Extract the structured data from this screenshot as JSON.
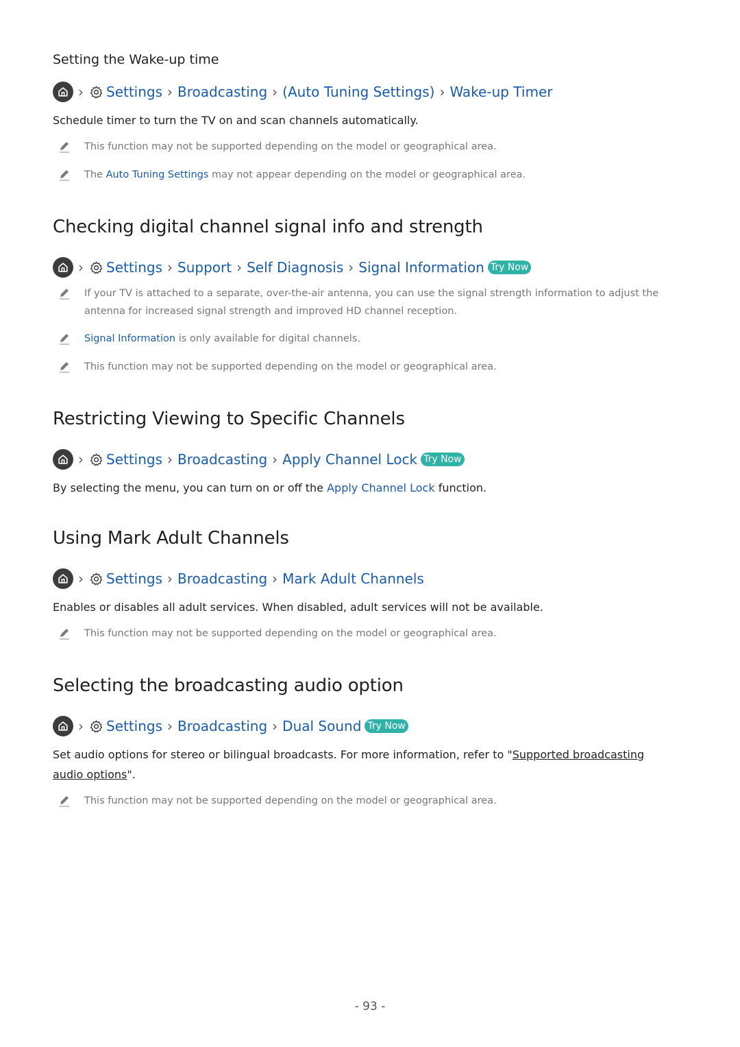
{
  "sections": {
    "wakeup": {
      "subheading": "Setting the Wake-up time",
      "breadcrumb": [
        "Settings",
        "Broadcasting",
        "Auto Tuning Settings",
        "Wake-up Timer"
      ],
      "paren_open": "(",
      "paren_close": ")",
      "body": "Schedule timer to turn the TV on and scan channels automatically.",
      "notes": [
        {
          "text": "This function may not be supported depending on the model or geographical area."
        },
        {
          "pre": "The ",
          "link": "Auto Tuning Settings",
          "post": " may not appear depending on the model or geographical area."
        }
      ]
    },
    "signal": {
      "heading": "Checking digital channel signal info and strength",
      "breadcrumb": [
        "Settings",
        "Support",
        "Self Diagnosis",
        "Signal Information"
      ],
      "try_now": "Try Now",
      "notes": [
        {
          "text": "If your TV is attached to a separate, over-the-air antenna, you can use the signal strength information to adjust the antenna for increased signal strength and improved HD channel reception."
        },
        {
          "link": "Signal Information",
          "post": " is only available for digital channels."
        },
        {
          "text": "This function may not be supported depending on the model or geographical area."
        }
      ]
    },
    "restrict": {
      "heading": "Restricting Viewing to Specific Channels",
      "breadcrumb": [
        "Settings",
        "Broadcasting",
        "Apply Channel Lock"
      ],
      "try_now": "Try Now",
      "body_pre": "By selecting the menu, you can turn on or off the ",
      "body_link": "Apply Channel Lock",
      "body_post": " function."
    },
    "adult": {
      "heading": "Using Mark Adult Channels",
      "breadcrumb": [
        "Settings",
        "Broadcasting",
        "Mark Adult Channels"
      ],
      "body": "Enables or disables all adult services. When disabled, adult services will not be available.",
      "notes": [
        {
          "text": "This function may not be supported depending on the model or geographical area."
        }
      ]
    },
    "audio": {
      "heading": "Selecting the broadcasting audio option",
      "breadcrumb": [
        "Settings",
        "Broadcasting",
        "Dual Sound"
      ],
      "try_now": "Try Now",
      "body_pre": "Set audio options for stereo or bilingual broadcasts. For more information, refer to \"",
      "body_link": "Supported broadcasting audio options",
      "body_post": "\".",
      "notes": [
        {
          "text": "This function may not be supported depending on the model or geographical area."
        }
      ]
    }
  },
  "icons": {
    "home": "home-icon",
    "settings": "gear-icon",
    "chevron": "chevron-right-icon",
    "note": "pencil-icon"
  },
  "colors": {
    "link": "#1a5ca8",
    "try_now": "#2fb3a8",
    "home_bg": "#3c3c3c",
    "note_text": "#777777"
  },
  "page_number": "- 93 -"
}
